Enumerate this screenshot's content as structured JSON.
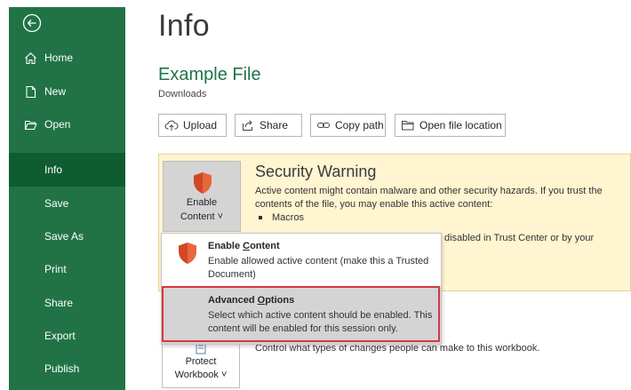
{
  "page": {
    "title": "Info"
  },
  "sidebar": {
    "back_icon": "back-arrow-icon",
    "items": [
      {
        "label": "Home",
        "icon": "home-icon"
      },
      {
        "label": "New",
        "icon": "new-document-icon"
      },
      {
        "label": "Open",
        "icon": "open-folder-icon"
      },
      {
        "label": "Info",
        "active": true
      },
      {
        "label": "Save"
      },
      {
        "label": "Save As"
      },
      {
        "label": "Print"
      },
      {
        "label": "Share"
      },
      {
        "label": "Export"
      },
      {
        "label": "Publish"
      }
    ],
    "accent_color": "#217346",
    "active_color": "#0e5c2f"
  },
  "file": {
    "name": "Example File",
    "location": "Downloads"
  },
  "toolbar": {
    "upload": "Upload",
    "share": "Share",
    "copy_path": "Copy path",
    "open_location": "Open file location"
  },
  "security": {
    "enable_label_1": "Enable",
    "enable_label_2": "Content ˅",
    "title": "Security Warning",
    "text": "Active content might contain malware and other security hazards. If you trust the contents of the file, you may enable this active content:",
    "bullet": "Macros",
    "tail": "disabled in Trust Center or by your",
    "panel_color": "#fff5d1"
  },
  "dropdown": {
    "enable": {
      "title_pre": "Enable ",
      "title_key": "C",
      "title_post": "ontent",
      "desc": "Enable allowed active content (make this a Trusted Document)"
    },
    "advanced": {
      "title_pre": "Advanced ",
      "title_key": "O",
      "title_post": "ptions",
      "desc": "Select which active content should be enabled. This content will be enabled for this session only."
    },
    "highlight_color": "#d9363e"
  },
  "protect": {
    "label_1": "Protect",
    "label_2": "Workbook ˅",
    "desc": "Control what types of changes people can make to this workbook."
  }
}
